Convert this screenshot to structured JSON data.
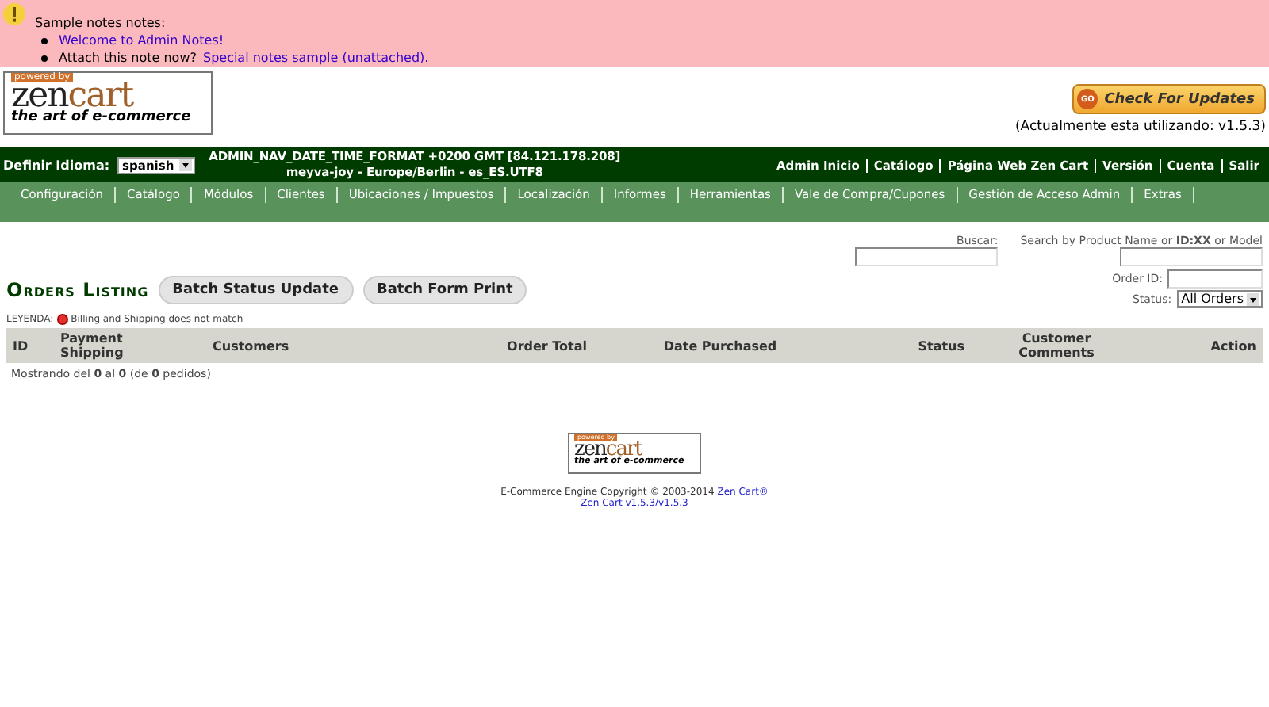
{
  "notes": {
    "title": "Sample notes notes:",
    "items": [
      {
        "link": "Welcome to Admin Notes!"
      },
      {
        "prefix": "Attach this note now?",
        "link": "Special notes sample (unattached)."
      }
    ]
  },
  "header_logo": {
    "top": "powered by",
    "zen": "zen",
    "cart": "cart",
    "tagline": "the art of e-commerce"
  },
  "updates": {
    "badge": "GO",
    "button": "Check For Updates",
    "version": "(Actualmente esta utilizando: v1.5.3)"
  },
  "topbar": {
    "language_label": "Definir Idioma:",
    "language": "spanish",
    "info": [
      "ADMIN_NAV_DATE_TIME_FORMAT +0200 GMT [84.121.178.208]",
      "meyva-joy - Europe/Berlin - es_ES.UTF8"
    ],
    "links": [
      "Admin Inicio",
      "Catálogo",
      "Página Web Zen Cart",
      "Versión",
      "Cuenta",
      "Salir"
    ]
  },
  "menu": [
    "Configuración",
    "Catálogo",
    "Módulos",
    "Clientes",
    "Ubicaciones / Impuestos",
    "Localización",
    "Informes",
    "Herramientas",
    "Vale de Compra/Cupones",
    "Gestión de Acceso Admin",
    "Extras"
  ],
  "search": {
    "label": "Buscar:",
    "product_label": "Search by Product Name or **ID:XX** or Model",
    "order_id_label": "Order ID:",
    "status_label": "Status:",
    "status_value": "All Orders"
  },
  "heading": "Orders Listing",
  "buttons": [
    "Batch Status Update",
    "Batch Form Print"
  ],
  "legend": {
    "label": "LEYENDA:",
    "text": "Billing and Shipping does not match"
  },
  "table": {
    "columns": [
      "ID",
      "Payment Shipping",
      "Customers",
      "Order Total",
      "Date Purchased",
      "Status",
      "Customer Comments",
      "Action"
    ]
  },
  "count": "Mostrando del **0** al **0** (de **0** pedidos)",
  "footer_logo": {
    "top": "powered by",
    "zen": "zen",
    "cart": "cart",
    "tagline": "the art of e-commerce"
  },
  "footer": {
    "copyright": "E-Commerce Engine Copyright © 2003-2014",
    "link": "Zen Cart®",
    "version": "Zen Cart v1.5.3/v1.5.3"
  }
}
